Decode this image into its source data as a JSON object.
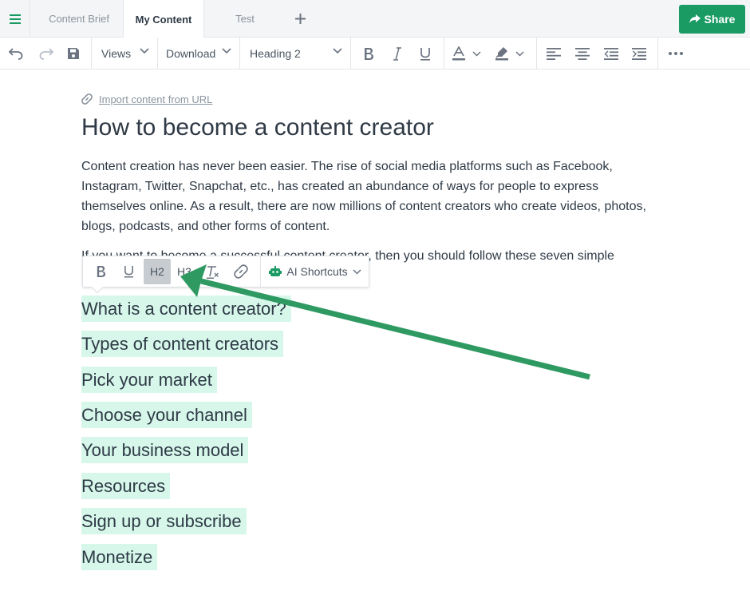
{
  "tabs": {
    "items": [
      {
        "label": "Content Brief"
      },
      {
        "label": "My Content"
      },
      {
        "label": "Test"
      }
    ],
    "active": "My Content"
  },
  "share_label": "Share",
  "toolbar": {
    "views_label": "Views",
    "download_label": "Download",
    "heading_label": "Heading 2"
  },
  "editor": {
    "import_link": "Import content from URL",
    "title": "How to become a content creator",
    "paragraph1": "Content creation has never been easier. The rise of social media platforms such as Facebook, Instagram, Twitter, Snapchat, etc., has created an abundance of ways for people to express themselves online. As a result, there are now millions of content creators who create videos, photos, blogs, podcasts, and other forms of content.",
    "paragraph2": "If you want to become a successful content creator, then you should follow these seven simple",
    "headings": [
      "What is a content creator?",
      "Types of content creators",
      "Pick your market",
      "Choose your channel",
      "Your business model",
      "Resources",
      "Sign up or subscribe",
      "Monetize"
    ]
  },
  "format_toolbar": {
    "h2_label": "H2",
    "h3_label": "H3",
    "ai_label": "AI Shortcuts",
    "active": "H2"
  },
  "colors": {
    "accent": "#1a9b63",
    "highlight": "#d6f7ea",
    "annotation_arrow": "#2e9a62"
  },
  "icons": [
    "menu-icon",
    "plus-icon",
    "share-icon",
    "undo-icon",
    "redo-icon",
    "save-icon",
    "chevron-down-icon",
    "bold-icon",
    "italic-icon",
    "underline-icon",
    "text-color-icon",
    "highlight-icon",
    "align-left-icon",
    "align-center-icon",
    "outdent-icon",
    "indent-icon",
    "more-icon",
    "link-icon",
    "clear-format-icon",
    "robot-icon"
  ]
}
